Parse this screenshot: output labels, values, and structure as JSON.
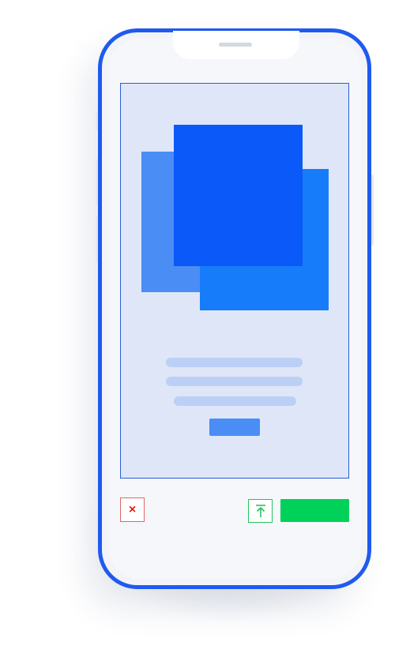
{
  "device": {
    "type": "smartphone",
    "frame_color": "#1f5af0"
  },
  "screen": {
    "background_color": "#dfe6f8",
    "illustration": {
      "layers": [
        "square-back",
        "square-right",
        "square-front"
      ],
      "colors": {
        "back": "#4a8df5",
        "right": "#177cfa",
        "front": "#0b59f8"
      }
    },
    "placeholder_lines": 3,
    "placeholder_color": "#bcd0f6",
    "cta_color": "#4a8df5"
  },
  "actions": {
    "close": {
      "icon": "close-icon",
      "glyph": "×",
      "color": "#d92020"
    },
    "upload": {
      "icon": "upload-to-top-icon",
      "color": "#22c55e"
    },
    "primary": {
      "label": "",
      "color": "#00d158"
    }
  }
}
